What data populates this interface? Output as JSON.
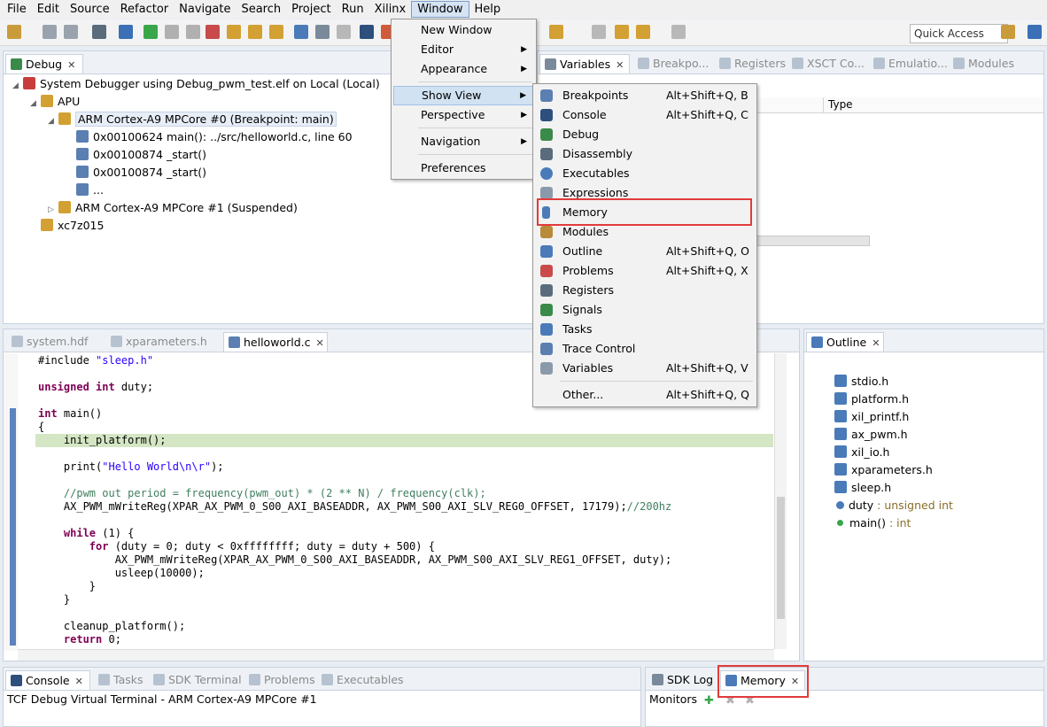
{
  "menubar": [
    "File",
    "Edit",
    "Source",
    "Refactor",
    "Navigate",
    "Search",
    "Project",
    "Run",
    "Xilinx",
    "Window",
    "Help"
  ],
  "toolbar": {
    "quick_access": "Quick Access"
  },
  "debug": {
    "tab": "Debug",
    "tree": [
      {
        "text": "System Debugger using Debug_pwm_test.elf on Local (Local)"
      },
      {
        "text": "APU"
      },
      {
        "text": "ARM Cortex-A9 MPCore #0 (Breakpoint: main)"
      },
      {
        "text": "0x00100624 main(): ../src/helloworld.c, line 60"
      },
      {
        "text": "0x00100874 _start()"
      },
      {
        "text": "0x00100874 _start()"
      },
      {
        "text": "..."
      },
      {
        "text": "ARM Cortex-A9 MPCore #1 (Suspended)"
      },
      {
        "text": "xc7z015"
      }
    ]
  },
  "variables": {
    "tabs": [
      "Variables",
      "Breakpo...",
      "Registers",
      "XSCT Co...",
      "Emulatio...",
      "Modules"
    ],
    "col_type": "Type"
  },
  "editor": {
    "tabs": [
      "system.hdf",
      "xparameters.h",
      "helloworld.c"
    ],
    "lines": {
      "l1a": "#include ",
      "l1b": "\"sleep.h\"",
      "l2a": "unsigned int",
      "l2b": " duty;",
      "l3a": "int",
      "l3b": " main()",
      "l4": "{",
      "l5": "    init_platform();",
      "l6a": "    print(",
      "l6b": "\"Hello World\\n\\r\"",
      "l6c": ");",
      "l7": "    //pwm out period = frequency(pwm_out) * (2 ** N) / frequency(clk);",
      "l8a": "    AX_PWM_mWriteReg(XPAR_AX_PWM_0_S00_AXI_BASEADDR, AX_PWM_S00_AXI_SLV_REG0_OFFSET, 17179);",
      "l8b": "//200hz",
      "l9a": "    while",
      "l9b": " (1) {",
      "l10a": "        for",
      "l10b": " (duty = 0; duty < 0xffffffff; duty = duty + 500) {",
      "l11": "            AX_PWM_mWriteReg(XPAR_AX_PWM_0_S00_AXI_BASEADDR, AX_PWM_S00_AXI_SLV_REG1_OFFSET, duty);",
      "l12": "            usleep(10000);",
      "l13": "        }",
      "l14": "    }",
      "l15": "    cleanup_platform();",
      "l16a": "    return",
      "l16b": " 0;"
    }
  },
  "outline": {
    "tab": "Outline",
    "items": [
      {
        "name": "stdio.h"
      },
      {
        "name": "platform.h"
      },
      {
        "name": "xil_printf.h"
      },
      {
        "name": "ax_pwm.h"
      },
      {
        "name": "xil_io.h"
      },
      {
        "name": "xparameters.h"
      },
      {
        "name": "sleep.h"
      },
      {
        "name": "duty",
        "type": " : unsigned int"
      },
      {
        "name": "main()",
        "type": " : int"
      }
    ]
  },
  "console": {
    "tabs": [
      "Console",
      "Tasks",
      "SDK Terminal",
      "Problems",
      "Executables"
    ],
    "text": "TCF Debug Virtual Terminal - ARM Cortex-A9 MPCore #1"
  },
  "memory_panel": {
    "tabs": [
      "SDK Log",
      "Memory"
    ],
    "monitors": "Monitors"
  },
  "window_menu": {
    "items": [
      "New Window",
      "Editor",
      "Appearance",
      "Show View",
      "Perspective",
      "Navigation",
      "Preferences"
    ]
  },
  "show_view_menu": {
    "items": [
      {
        "label": "Breakpoints",
        "accel": "Alt+Shift+Q, B"
      },
      {
        "label": "Console",
        "accel": "Alt+Shift+Q, C"
      },
      {
        "label": "Debug",
        "accel": ""
      },
      {
        "label": "Disassembly",
        "accel": ""
      },
      {
        "label": "Executables",
        "accel": ""
      },
      {
        "label": "Expressions",
        "accel": ""
      },
      {
        "label": "Memory",
        "accel": ""
      },
      {
        "label": "Modules",
        "accel": ""
      },
      {
        "label": "Outline",
        "accel": "Alt+Shift+Q, O"
      },
      {
        "label": "Problems",
        "accel": "Alt+Shift+Q, X"
      },
      {
        "label": "Registers",
        "accel": ""
      },
      {
        "label": "Signals",
        "accel": ""
      },
      {
        "label": "Tasks",
        "accel": ""
      },
      {
        "label": "Trace Control",
        "accel": ""
      },
      {
        "label": "Variables",
        "accel": "Alt+Shift+Q, V"
      },
      {
        "label": "Other...",
        "accel": "Alt+Shift+Q, Q"
      }
    ]
  },
  "colors": {
    "accent_red": "#e23b3b",
    "highlight": "#d1e2f2"
  }
}
